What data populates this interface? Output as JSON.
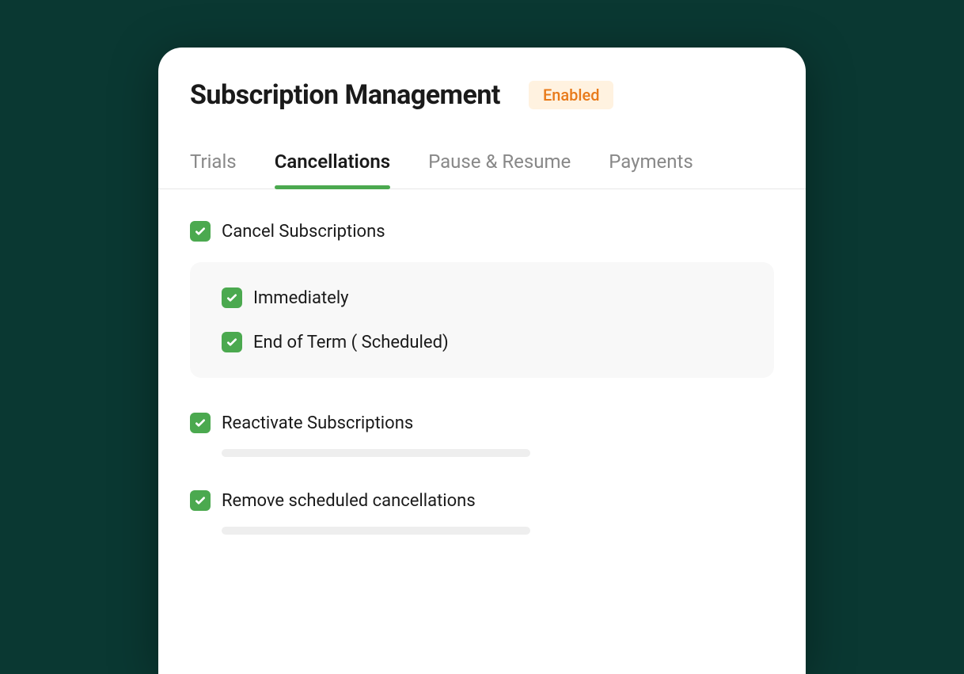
{
  "header": {
    "title": "Subscription Management",
    "badge": "Enabled"
  },
  "tabs": [
    {
      "label": "Trials",
      "active": false
    },
    {
      "label": "Cancellations",
      "active": true
    },
    {
      "label": "Pause & Resume",
      "active": false
    },
    {
      "label": "Payments",
      "active": false
    }
  ],
  "options": {
    "cancel": {
      "label": "Cancel Subscriptions",
      "sub": [
        {
          "label": "Immediately"
        },
        {
          "label": "End of Term ( Scheduled)"
        }
      ]
    },
    "reactivate": {
      "label": "Reactivate Subscriptions"
    },
    "remove": {
      "label": "Remove scheduled cancellations"
    }
  }
}
